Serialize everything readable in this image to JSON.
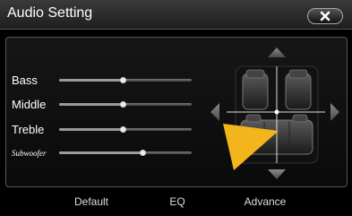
{
  "window": {
    "title": "Audio Setting",
    "close_icon": "close-x-icon"
  },
  "sliders": [
    {
      "label": "Bass",
      "level_percent": 48
    },
    {
      "label": "Middle",
      "level_percent": 48
    },
    {
      "label": "Treble",
      "level_percent": 48
    },
    {
      "label": "Subwoofer",
      "level_percent": 63
    }
  ],
  "balance": {
    "arrows": [
      "arrow-up-icon",
      "arrow-down-icon",
      "arrow-left-icon",
      "arrow-right-icon"
    ],
    "pointer_icon": "yellow-pointer-icon"
  },
  "bottom": {
    "default_label": "Default",
    "eq_label": "EQ",
    "advance_label": "Advance"
  },
  "colors": {
    "pointer": "#f2b51b",
    "background": "#000000"
  }
}
